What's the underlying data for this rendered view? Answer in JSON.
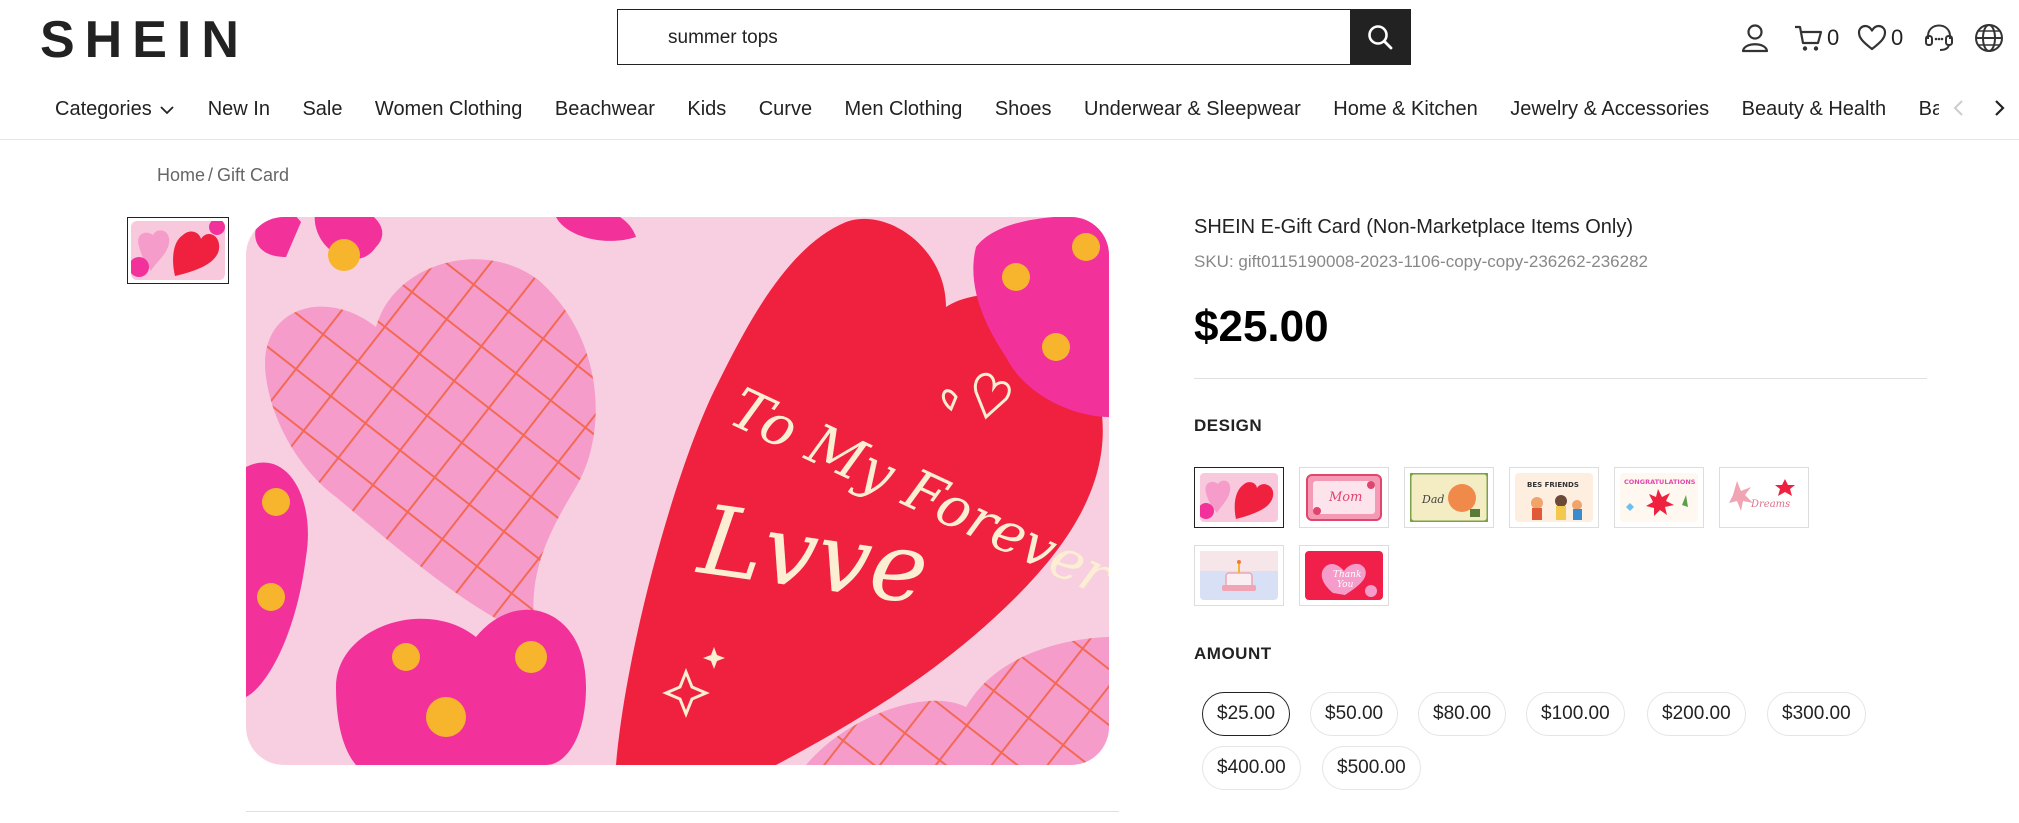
{
  "header": {
    "logo": "SHEIN",
    "search_value": "summer tops",
    "cart_count": "0",
    "wishlist_count": "0"
  },
  "nav": {
    "categories_label": "Categories",
    "items": [
      "New In",
      "Sale",
      "Women Clothing",
      "Beachwear",
      "Kids",
      "Curve",
      "Men Clothing",
      "Shoes",
      "Underwear & Sleepwear",
      "Home & Kitchen",
      "Jewelry & Accessories",
      "Beauty & Health",
      "Baby"
    ]
  },
  "breadcrumb": {
    "home": "Home",
    "separator": "/",
    "current": "Gift Card"
  },
  "product": {
    "title": "SHEIN E-Gift Card (Non-Marketplace Items Only)",
    "sku": "SKU: gift0115190008-2023-1106-copy-copy-236262-236282",
    "price": "$25.00",
    "image_text_line1": "To My Forever",
    "image_text_line2": "Lvve",
    "design_label": "DESIGN",
    "amount_label": "AMOUNT",
    "selected_design_index": 0,
    "selected_amount": "$25.00",
    "amounts": [
      "$25.00",
      "$50.00",
      "$80.00",
      "$100.00",
      "$200.00",
      "$300.00",
      "$400.00",
      "$500.00"
    ]
  },
  "icons": {
    "search": "search-icon",
    "account": "user-icon",
    "cart": "cart-icon",
    "wishlist": "heart-icon",
    "support": "headset-icon",
    "language": "globe-icon"
  },
  "colors": {
    "accent": "#222222",
    "card_pink": "#f8c9dc",
    "card_red": "#f0203f",
    "card_magenta": "#f2329a",
    "card_cream": "#fbeed2"
  }
}
